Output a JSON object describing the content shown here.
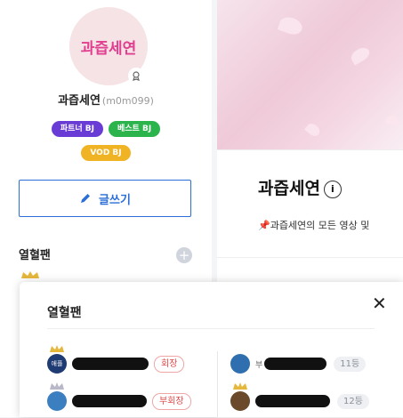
{
  "profile": {
    "avatar_text": "과즙세연",
    "nickname": "과즙세연",
    "user_id": "(m0m099)",
    "badges": [
      "파트너 BJ",
      "베스트 BJ",
      "VOD BJ"
    ],
    "write_button": "글쓰기",
    "fan_section_title": "열혈팬",
    "fan_plus": "+"
  },
  "broadcaster": {
    "name": "과즙세연",
    "info_icon": "i",
    "description": "📌과즙세연의 모든 영상 및"
  },
  "popup": {
    "title": "열혈팬",
    "close": "✕",
    "fans": [
      {
        "label": "회장",
        "avatar_text": "애플"
      },
      {
        "label": "부회장"
      },
      {
        "label": "11등",
        "prefix": "부"
      },
      {
        "label": "12등"
      }
    ]
  },
  "colors": {
    "accent_blue": "#2b6ed8",
    "partner": "#6a3cd6",
    "best": "#2bb34c",
    "vod": "#f0b323",
    "rank_red": "#e04848"
  }
}
